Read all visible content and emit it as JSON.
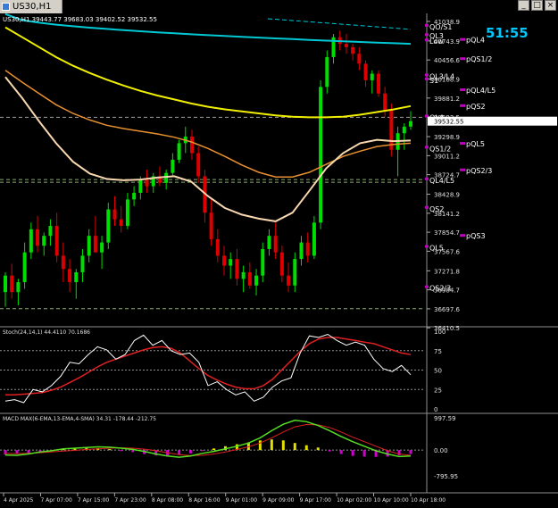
{
  "window": {
    "tab_title": "US30,H1",
    "buttons": [
      "_",
      "□",
      "×"
    ]
  },
  "header": {
    "ohlc_line": "US30,H1  39443.77 39683.03 39402.52 39532.55",
    "timer": "51:55"
  },
  "colors": {
    "background": "#000000",
    "bull": "#00dd00",
    "bear": "#dd0000",
    "ema_slow": "#00c8d4",
    "ma_yellow": "#f0f000",
    "ma_orange": "#e89030",
    "ma_cream": "#f8d8b0",
    "stoch_main": "#ffffff",
    "stoch_signal": "#e02020",
    "macd_line": "#55dd22",
    "macd_signal": "#e02020",
    "hist_pos": "#e0e000",
    "hist_neg": "#d000d0",
    "timer": "#00c8ff"
  },
  "chart_data": [
    {
      "type": "candlestick",
      "symbol": "US30",
      "timeframe": "H1",
      "yticks": [
        41038.9,
        40743.9,
        40456.6,
        40168.9,
        39881.2,
        39593.5,
        39298.9,
        39011.2,
        38724.7,
        38428.9,
        38141.2,
        37854.7,
        37567.6,
        37271.8,
        36984.7,
        36697.6,
        36410.5
      ],
      "ylim": [
        36410.5,
        41038.9
      ],
      "current_price": 39532.55,
      "current_price_label": "39532.55",
      "xticks": [
        "4 Apr 2025",
        "7 Apr 07:00",
        "7 Apr 15:00",
        "7 Apr 23:00",
        "8 Apr 08:00",
        "8 Apr 16:00",
        "9 Apr 01:00",
        "9 Apr 09:00",
        "9 Apr 17:00",
        "10 Apr 02:00",
        "10 Apr 10:00",
        "10 Apr 18:00"
      ],
      "levels_left": [
        {
          "label": "QO/S1",
          "value": 40960
        },
        {
          "label": "QL3",
          "value": 40820
        },
        {
          "label": "Low",
          "value": 40740
        },
        {
          "label": "QL3/L4",
          "value": 40210
        },
        {
          "label": "S1",
          "value": 40150
        },
        {
          "label": "QL4",
          "value": 39590
        },
        {
          "label": "QS1/2",
          "value": 39120
        },
        {
          "label": "QL4/L5",
          "value": 38640
        },
        {
          "label": "QS2",
          "value": 38210
        },
        {
          "label": "QL5",
          "value": 37620
        },
        {
          "label": "QS2/3",
          "value": 37010
        }
      ],
      "levels_right": [
        {
          "label": "pQL4",
          "value": 40760
        },
        {
          "label": "pQS1/2",
          "value": 40470
        },
        {
          "label": "pQL4/L5",
          "value": 40000
        },
        {
          "label": "pQS2",
          "value": 39760
        },
        {
          "label": "pQL5",
          "value": 39190
        },
        {
          "label": "pQS2/3",
          "value": 38790
        },
        {
          "label": "pQS3",
          "value": 37800
        }
      ],
      "horizontal_lines": [
        39590,
        38650,
        38610,
        36700
      ],
      "candles": [
        [
          36950,
          37250,
          36730,
          37200
        ],
        [
          37200,
          37380,
          36850,
          36950
        ],
        [
          36950,
          37150,
          36750,
          37100
        ],
        [
          37100,
          37700,
          37000,
          37550
        ],
        [
          37550,
          38000,
          37450,
          37900
        ],
        [
          37900,
          38100,
          37550,
          37650
        ],
        [
          37650,
          37850,
          37500,
          37800
        ],
        [
          37800,
          38050,
          37650,
          37950
        ],
        [
          37950,
          38150,
          37400,
          37500
        ],
        [
          37500,
          37700,
          37100,
          37300
        ],
        [
          37300,
          37450,
          36950,
          37100
        ],
        [
          37100,
          37300,
          36850,
          37250
        ],
        [
          37250,
          37600,
          37100,
          37500
        ],
        [
          37500,
          37900,
          37400,
          37800
        ],
        [
          37800,
          38100,
          37700,
          37550
        ],
        [
          37550,
          37800,
          37300,
          37700
        ],
        [
          37700,
          38300,
          37600,
          38200
        ],
        [
          38200,
          38400,
          37950,
          38050
        ],
        [
          38050,
          38250,
          37850,
          37950
        ],
        [
          37950,
          38450,
          37900,
          38350
        ],
        [
          38350,
          38550,
          38250,
          38450
        ],
        [
          38450,
          38700,
          38350,
          38650
        ],
        [
          38650,
          38800,
          38450,
          38550
        ],
        [
          38550,
          38750,
          38450,
          38700
        ],
        [
          38700,
          38850,
          38550,
          38600
        ],
        [
          38600,
          38800,
          38500,
          38750
        ],
        [
          38750,
          39050,
          38700,
          38950
        ],
        [
          38950,
          39250,
          38900,
          39200
        ],
        [
          39200,
          39450,
          39050,
          39300
        ],
        [
          39300,
          39400,
          38950,
          39050
        ],
        [
          39050,
          39150,
          38600,
          38700
        ],
        [
          38700,
          38800,
          38000,
          38150
        ],
        [
          38150,
          38350,
          37650,
          37750
        ],
        [
          37750,
          37900,
          37400,
          37500
        ],
        [
          37500,
          37650,
          37200,
          37350
        ],
        [
          37350,
          37550,
          37150,
          37450
        ],
        [
          37450,
          37600,
          37050,
          37150
        ],
        [
          37150,
          37350,
          36950,
          37250
        ],
        [
          37250,
          37400,
          37000,
          37050
        ],
        [
          37050,
          37300,
          36900,
          37200
        ],
        [
          37200,
          37700,
          37100,
          37600
        ],
        [
          37600,
          37900,
          37500,
          37800
        ],
        [
          37800,
          38000,
          37450,
          37550
        ],
        [
          37550,
          37650,
          37100,
          37200
        ],
        [
          37200,
          37400,
          36950,
          37050
        ],
        [
          37050,
          37550,
          36950,
          37450
        ],
        [
          37450,
          37800,
          37350,
          37700
        ],
        [
          37700,
          37850,
          37400,
          37500
        ],
        [
          37500,
          38100,
          37450,
          38000
        ],
        [
          38000,
          40150,
          37900,
          40050
        ],
        [
          40050,
          40600,
          39950,
          40500
        ],
        [
          40500,
          40850,
          40400,
          40800
        ],
        [
          40800,
          40900,
          40600,
          40700
        ],
        [
          40700,
          40850,
          40550,
          40650
        ],
        [
          40650,
          40700,
          40450,
          40550
        ],
        [
          40550,
          40650,
          40300,
          40400
        ],
        [
          40400,
          40450,
          40050,
          40150
        ],
        [
          40150,
          40300,
          39950,
          40250
        ],
        [
          40250,
          40300,
          39900,
          39950
        ],
        [
          39950,
          40050,
          39600,
          39700
        ],
        [
          39700,
          39800,
          39000,
          39100
        ],
        [
          39100,
          39450,
          38700,
          39350
        ],
        [
          39350,
          39500,
          39100,
          39450
        ],
        [
          39450,
          39683,
          39402,
          39532
        ]
      ],
      "ma_lines": {
        "cyan": {
          "start": 41150,
          "end": 40700
        },
        "yellow": [
          40950,
          40800,
          40650,
          40500,
          40370,
          40260,
          40160,
          40070,
          39990,
          39920,
          39860,
          39800,
          39750,
          39710,
          39680,
          39650,
          39620,
          39600,
          39590,
          39590,
          39600,
          39630,
          39670,
          39710,
          39760
        ],
        "orange": [
          40300,
          40120,
          39950,
          39780,
          39650,
          39550,
          39470,
          39420,
          39380,
          39340,
          39290,
          39220,
          39120,
          39000,
          38870,
          38760,
          38690,
          38690,
          38760,
          38880,
          39000,
          39080,
          39150,
          39180,
          39200
        ],
        "cream": [
          40200,
          39880,
          39530,
          39200,
          38920,
          38740,
          38660,
          38640,
          38650,
          38680,
          38700,
          38620,
          38400,
          38220,
          38120,
          38060,
          38020,
          38150,
          38480,
          38820,
          39050,
          39200,
          39250,
          39230,
          39240
        ]
      }
    },
    {
      "type": "line",
      "name": "Stoch(24,14,1) 44.4110 70.1686",
      "yticks": [
        100,
        75,
        50,
        25,
        0
      ],
      "ylim": [
        0,
        100
      ],
      "main": [
        10,
        12,
        8,
        25,
        22,
        30,
        42,
        60,
        58,
        70,
        80,
        76,
        64,
        70,
        88,
        95,
        82,
        88,
        75,
        70,
        72,
        60,
        30,
        35,
        25,
        18,
        22,
        10,
        15,
        28,
        36,
        40,
        72,
        94,
        92,
        96,
        88,
        82,
        86,
        82,
        64,
        52,
        48,
        56,
        44
      ],
      "signal": [
        18,
        18,
        19,
        20,
        21,
        24,
        28,
        34,
        40,
        47,
        54,
        60,
        64,
        68,
        72,
        76,
        79,
        80,
        78,
        72,
        62,
        52,
        43,
        37,
        32,
        28,
        26,
        26,
        30,
        38,
        50,
        62,
        74,
        84,
        90,
        92,
        92,
        90,
        88,
        86,
        84,
        80,
        76,
        72,
        70
      ]
    },
    {
      "type": "line",
      "name": "MACD MAX(6-EMA,13-EMA,4-SMA) 34.31 -178.44 -212.75",
      "yticks": [
        997.59,
        0.0,
        -795.95
      ],
      "ylim": [
        -795.95,
        997.59
      ],
      "macd": [
        -150,
        -160,
        -120,
        -60,
        -20,
        40,
        60,
        80,
        100,
        90,
        60,
        20,
        -40,
        -120,
        -180,
        -220,
        -180,
        -100,
        -40,
        40,
        120,
        220,
        380,
        600,
        800,
        920,
        880,
        760,
        600,
        420,
        260,
        120,
        -20,
        -120,
        -200,
        -180
      ],
      "signal": [
        -100,
        -110,
        -100,
        -80,
        -55,
        -30,
        -10,
        20,
        40,
        60,
        70,
        60,
        30,
        -20,
        -80,
        -140,
        -170,
        -160,
        -120,
        -60,
        20,
        100,
        220,
        380,
        560,
        720,
        790,
        780,
        700,
        560,
        400,
        260,
        120,
        -20,
        -120,
        -160
      ],
      "histogram": [
        -150,
        -120,
        -90,
        -60,
        -40,
        40,
        70,
        80,
        60,
        30,
        -20,
        -60,
        -120,
        -160,
        -170,
        -150,
        -100,
        -30,
        50,
        120,
        180,
        240,
        300,
        330,
        300,
        220,
        150,
        80,
        -40,
        -120,
        -180,
        -200,
        -210,
        -200,
        -160,
        -120
      ]
    }
  ]
}
